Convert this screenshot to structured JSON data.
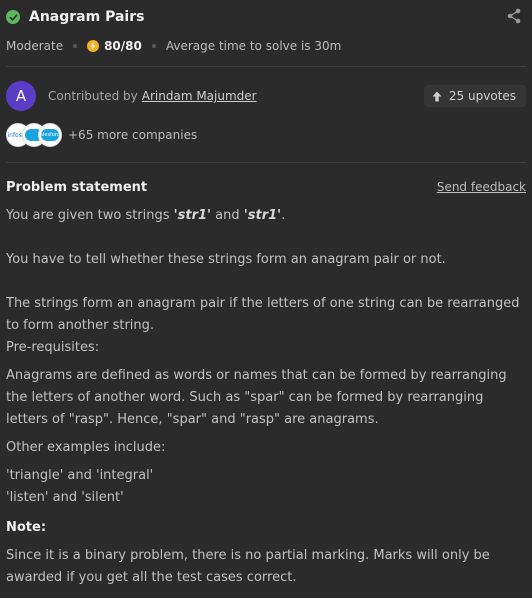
{
  "header": {
    "title": "Anagram Pairs"
  },
  "meta": {
    "difficulty": "Moderate",
    "score": "80/80",
    "avg_time": "Average time to solve is 30m"
  },
  "contributor": {
    "avatar_letter": "A",
    "prefix": "Contributed by",
    "name": "Arindam Majumder",
    "upvotes": "25 upvotes"
  },
  "companies": {
    "logo1": "infosys",
    "logo2": "",
    "logo3": "salesforce",
    "more": "+65 more companies"
  },
  "problem": {
    "heading": "Problem statement",
    "send_feedback": "Send feedback",
    "p1_pre": "You are given two strings ",
    "p1_s1": "'str1'",
    "p1_mid": " and ",
    "p1_s2": "'str1'",
    "p1_post": ".",
    "p2": "You have to tell whether these strings form an anagram pair or not.",
    "p3": "The strings form an anagram pair if the letters of one string can be rearranged to form another string.",
    "p4": "Pre-requisites:",
    "p5": "Anagrams are defined as words or names that can be formed by rearranging the letters of another word. Such as \"spar\" can be formed by rearranging letters of \"rasp\". Hence, \"spar\" and \"rasp\" are anagrams.",
    "p6": "Other examples include:",
    "p7a": "'triangle' and 'integral'",
    "p7b": "'listen' and 'silent'",
    "note": "Note:",
    "p8": "Since it is a binary problem, there is no partial marking. Marks will only be awarded if you get all the test cases correct."
  },
  "colors": {
    "background": "#2b2b2b",
    "success": "#5bb85d",
    "score": "#f2b32a",
    "avatar": "#5a3ec8"
  }
}
